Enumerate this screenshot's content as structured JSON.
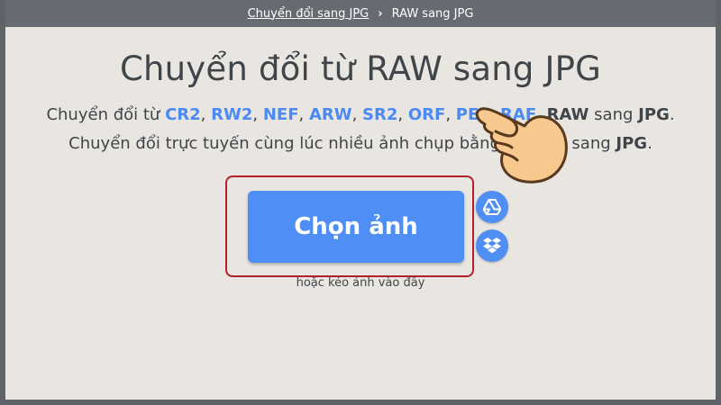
{
  "breadcrumb": {
    "parent_label": "Chuyển đổi sang JPG",
    "separator": "›",
    "current_label": "RAW sang JPG"
  },
  "page_title": "Chuyển đổi từ RAW sang JPG",
  "subtitle_line1": {
    "prefix": "Chuyển đổi từ",
    "formats": [
      "CR2",
      "RW2",
      "NEF",
      "ARW",
      "SR2",
      "ORF",
      "PEF",
      "RAF"
    ],
    "raw_label": "RAW",
    "mid": "sang",
    "target": "JPG",
    "end": "."
  },
  "subtitle_line2": {
    "text": "Chuyển đổi trực tuyến cùng lúc nhiều ảnh chụp bằng camera sang",
    "target": "JPG",
    "end": "."
  },
  "upload": {
    "select_label": "Chọn ảnh",
    "drop_hint": "hoặc kéo ảnh vào đây"
  },
  "icons": {
    "gdrive": "google-drive-icon",
    "dropbox": "dropbox-icon",
    "pointer": "pointing-hand-icon"
  },
  "colors": {
    "accent": "#4e8ef5",
    "highlight": "#b4202a",
    "background": "#e9e6e2",
    "topbar": "#666b71",
    "text": "#3f4549"
  }
}
